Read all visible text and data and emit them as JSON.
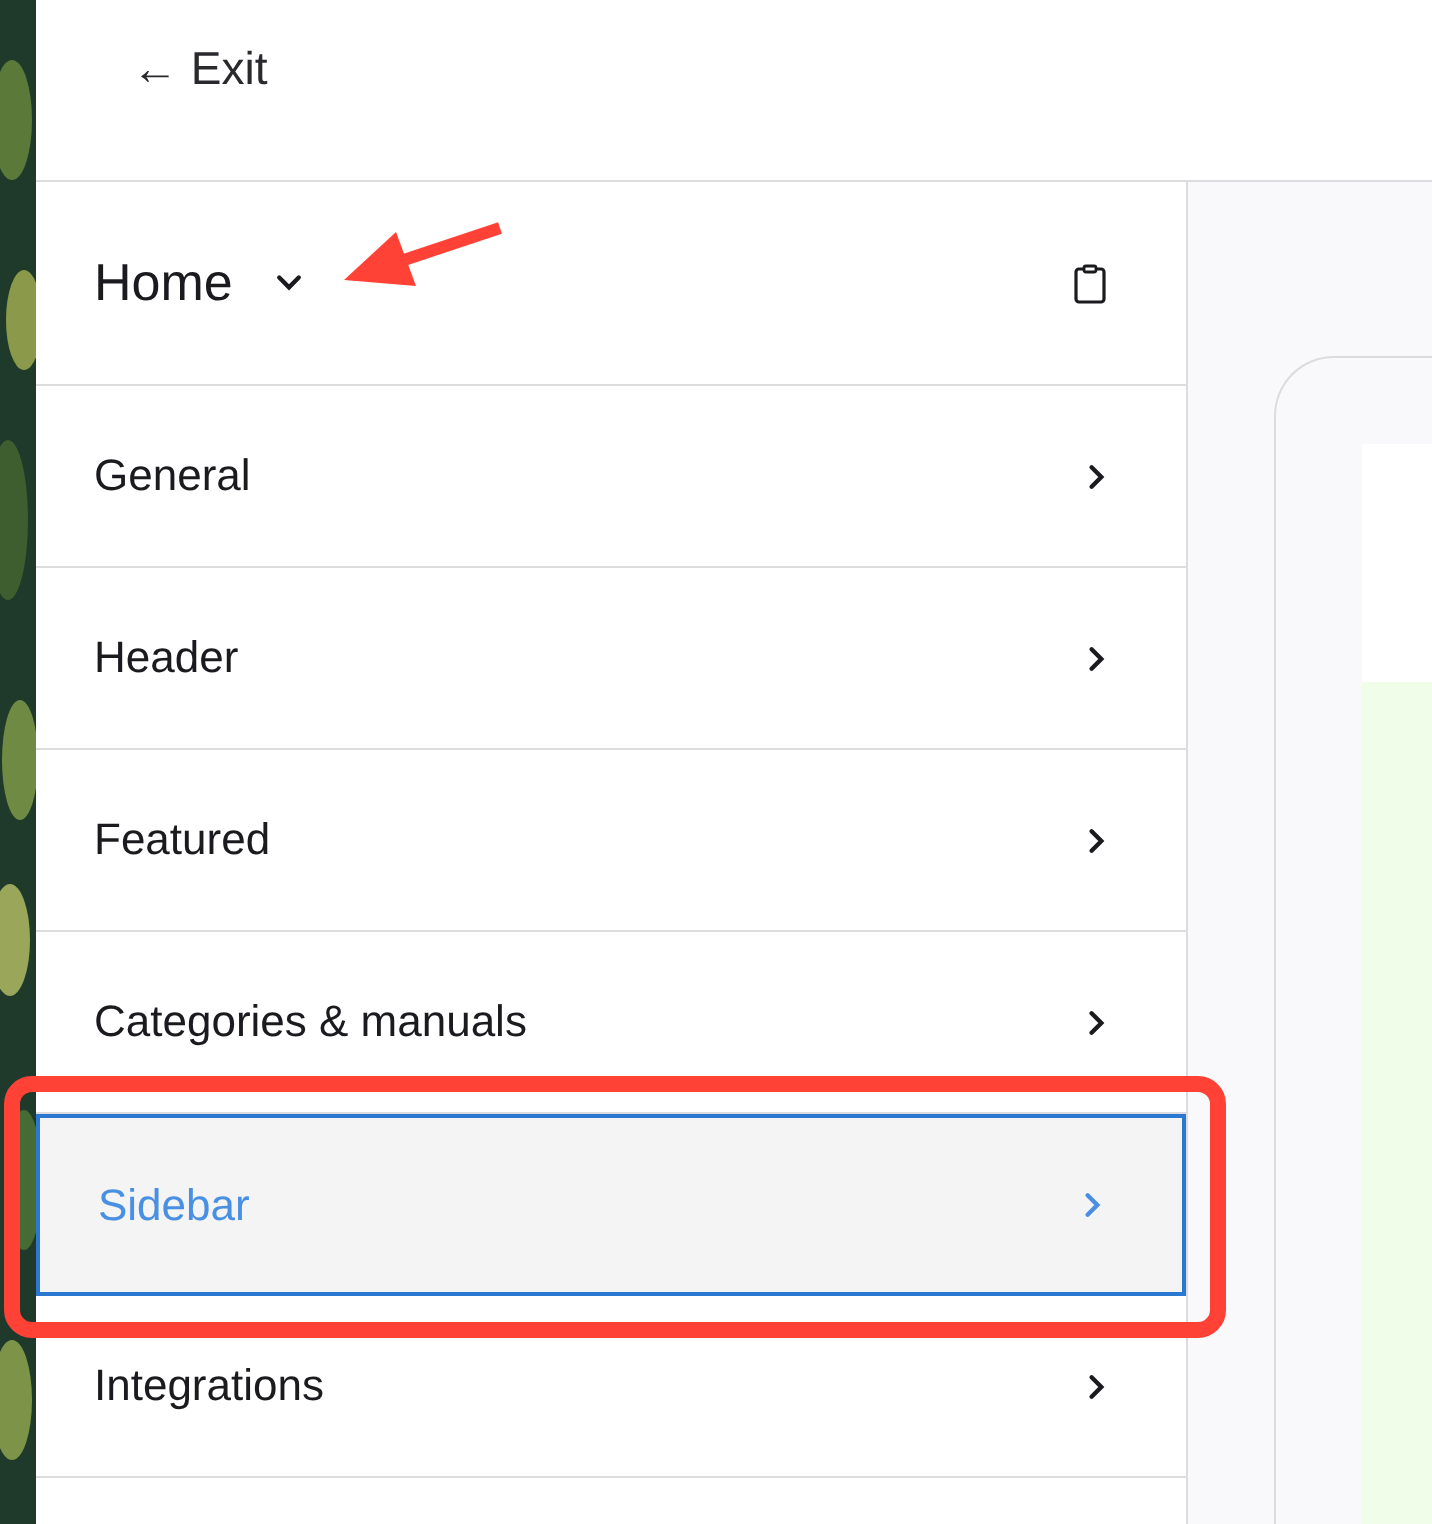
{
  "header": {
    "exit_label": "← Exit"
  },
  "panel": {
    "title": "Home",
    "expanded": false
  },
  "menu_items": [
    {
      "label": "General",
      "selected": false
    },
    {
      "label": "Header",
      "selected": false
    },
    {
      "label": "Featured",
      "selected": false
    },
    {
      "label": "Categories & manuals",
      "selected": false
    },
    {
      "label": "Sidebar",
      "selected": true
    },
    {
      "label": "Integrations",
      "selected": false
    }
  ]
}
